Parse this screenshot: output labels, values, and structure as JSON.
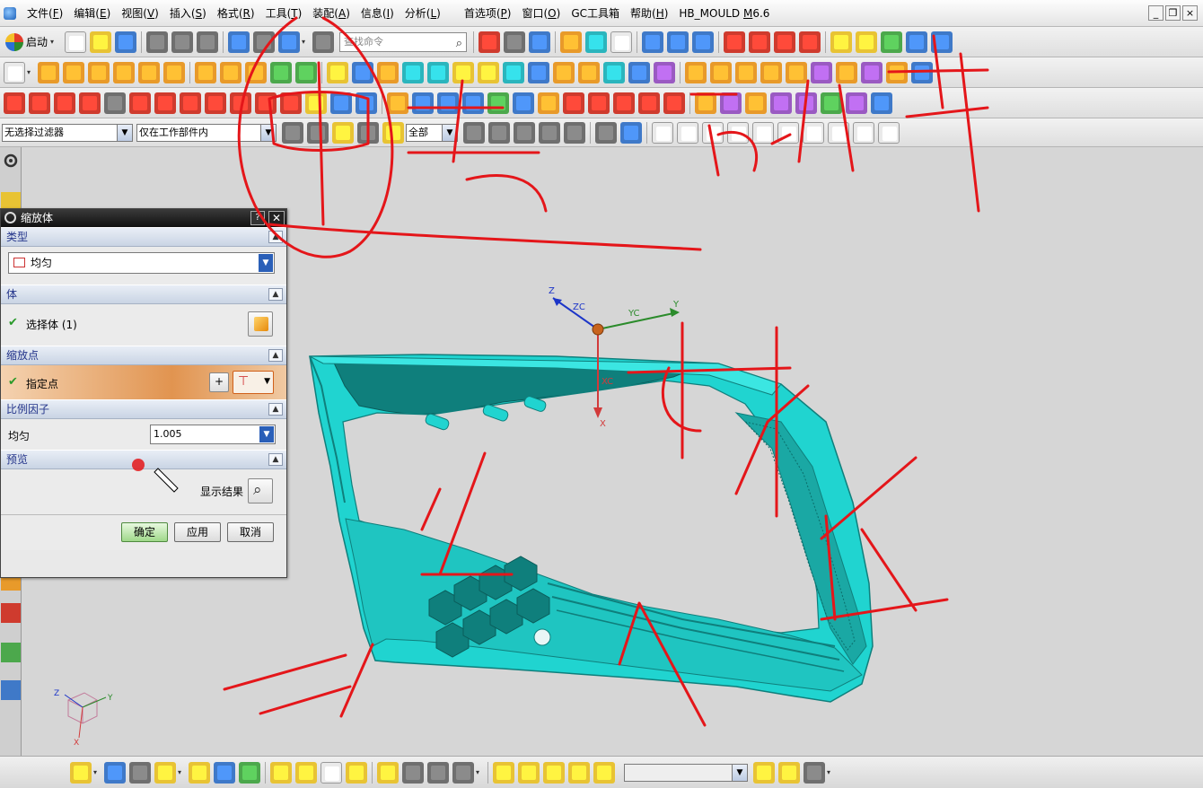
{
  "menubar": {
    "items": [
      {
        "label": "文件(",
        "key": "F",
        "end": ")"
      },
      {
        "label": "编辑(",
        "key": "E",
        "end": ")"
      },
      {
        "label": "视图(",
        "key": "V",
        "end": ")"
      },
      {
        "label": "插入(",
        "key": "S",
        "end": ")"
      },
      {
        "label": "格式(",
        "key": "R",
        "end": ")"
      },
      {
        "label": "工具(",
        "key": "T",
        "end": ")"
      },
      {
        "label": "装配(",
        "key": "A",
        "end": ")"
      },
      {
        "label": "信息(",
        "key": "I",
        "end": ")"
      },
      {
        "label": "分析(",
        "key": "L",
        "end": ")"
      },
      {
        "label": "首选项(",
        "key": "P",
        "end": ")"
      },
      {
        "label": "窗口(",
        "key": "O",
        "end": ")"
      },
      {
        "label": "GC工具箱",
        "key": "",
        "end": ""
      },
      {
        "label": "帮助(",
        "key": "H",
        "end": ")"
      },
      {
        "label": "HB_MOULD ",
        "key": "M",
        "end": "6.6"
      }
    ]
  },
  "toolbar": {
    "start_label": "启动",
    "search_placeholder": "查找命令",
    "filter_select": "无选择过滤器",
    "scope_select": "仅在工作部件内",
    "all_select": "全部"
  },
  "dialog": {
    "title": "缩放体",
    "sections": {
      "type": "类型",
      "body": "体",
      "scale_point": "缩放点",
      "scale_factor": "比例因子",
      "preview": "预览"
    },
    "type_value": "均匀",
    "select_body": "选择体 (1)",
    "specify_point": "指定点",
    "uniform_label": "均匀",
    "uniform_value": "1.005",
    "show_result": "显示结果",
    "buttons": {
      "ok": "确定",
      "apply": "应用",
      "cancel": "取消"
    }
  },
  "triad": {
    "z": "Z",
    "zc": "ZC",
    "yc": "YC",
    "y": "Y",
    "xc": "XC",
    "x": "X"
  },
  "view_triad": {
    "z": "Z",
    "y": "Y",
    "x": "X"
  },
  "colors": {
    "part": "#20d4d0",
    "part_dark": "#0f7f7c",
    "annotation": "#e4161a",
    "dialog_title": "#111111",
    "section_text": "#23348a"
  }
}
